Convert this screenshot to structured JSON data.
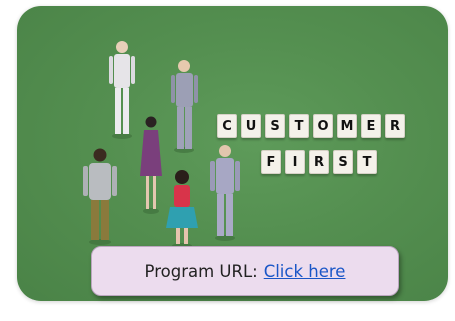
{
  "photo": {
    "description_icon": "figurines-photo",
    "tile_row_1": [
      "C",
      "U",
      "S",
      "T",
      "O",
      "M",
      "E",
      "R"
    ],
    "tile_row_2": [
      "F",
      "I",
      "R",
      "S",
      "T"
    ]
  },
  "program_box": {
    "label": "Program URL:",
    "link_text": "Click here"
  },
  "colors": {
    "background_green": "#548f50",
    "box_fill": "#ecdcee",
    "link": "#1a56c7"
  }
}
